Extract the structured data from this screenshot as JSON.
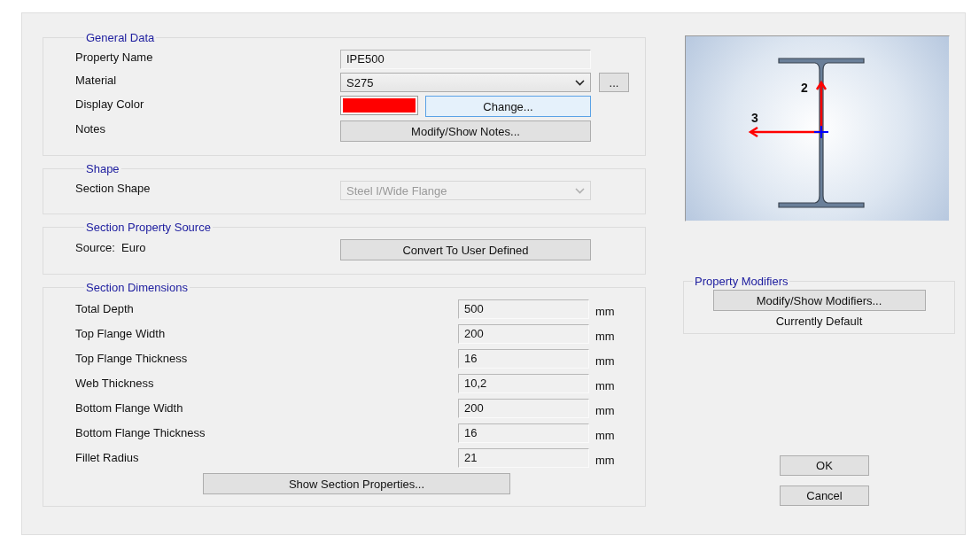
{
  "general_data": {
    "title": "General Data",
    "property_name": {
      "label": "Property Name",
      "value": "IPE500"
    },
    "material": {
      "label": "Material",
      "value": "S275",
      "browse": "..."
    },
    "display_color": {
      "label": "Display Color",
      "color": "#ff0000",
      "button": "Change...",
      "focused": true
    },
    "notes": {
      "label": "Notes",
      "button": "Modify/Show Notes..."
    }
  },
  "shape": {
    "title": "Shape",
    "label": "Section Shape",
    "value": "Steel I/Wide Flange",
    "disabled": true
  },
  "source": {
    "title": "Section Property Source",
    "label": "Source:  Euro",
    "button": "Convert To User Defined"
  },
  "dimensions": {
    "title": "Section Dimensions",
    "rows": [
      {
        "label": "Total Depth",
        "value": "500",
        "unit": "mm"
      },
      {
        "label": "Top Flange Width",
        "value": "200",
        "unit": "mm"
      },
      {
        "label": "Top Flange Thickness",
        "value": "16",
        "unit": "mm"
      },
      {
        "label": "Web Thickness",
        "value": "10,2",
        "unit": "mm"
      },
      {
        "label": "Bottom Flange Width",
        "value": "200",
        "unit": "mm"
      },
      {
        "label": "Bottom Flange Thickness",
        "value": "16",
        "unit": "mm"
      },
      {
        "label": "Fillet Radius",
        "value": "21",
        "unit": "mm"
      }
    ],
    "button": "Show Section Properties..."
  },
  "preview": {
    "axis_labels": [
      "2",
      "3"
    ]
  },
  "modifiers": {
    "title": "Property Modifiers",
    "button": "Modify/Show Modifiers...",
    "status": "Currently Default"
  },
  "buttons": [
    "OK",
    "Cancel"
  ]
}
